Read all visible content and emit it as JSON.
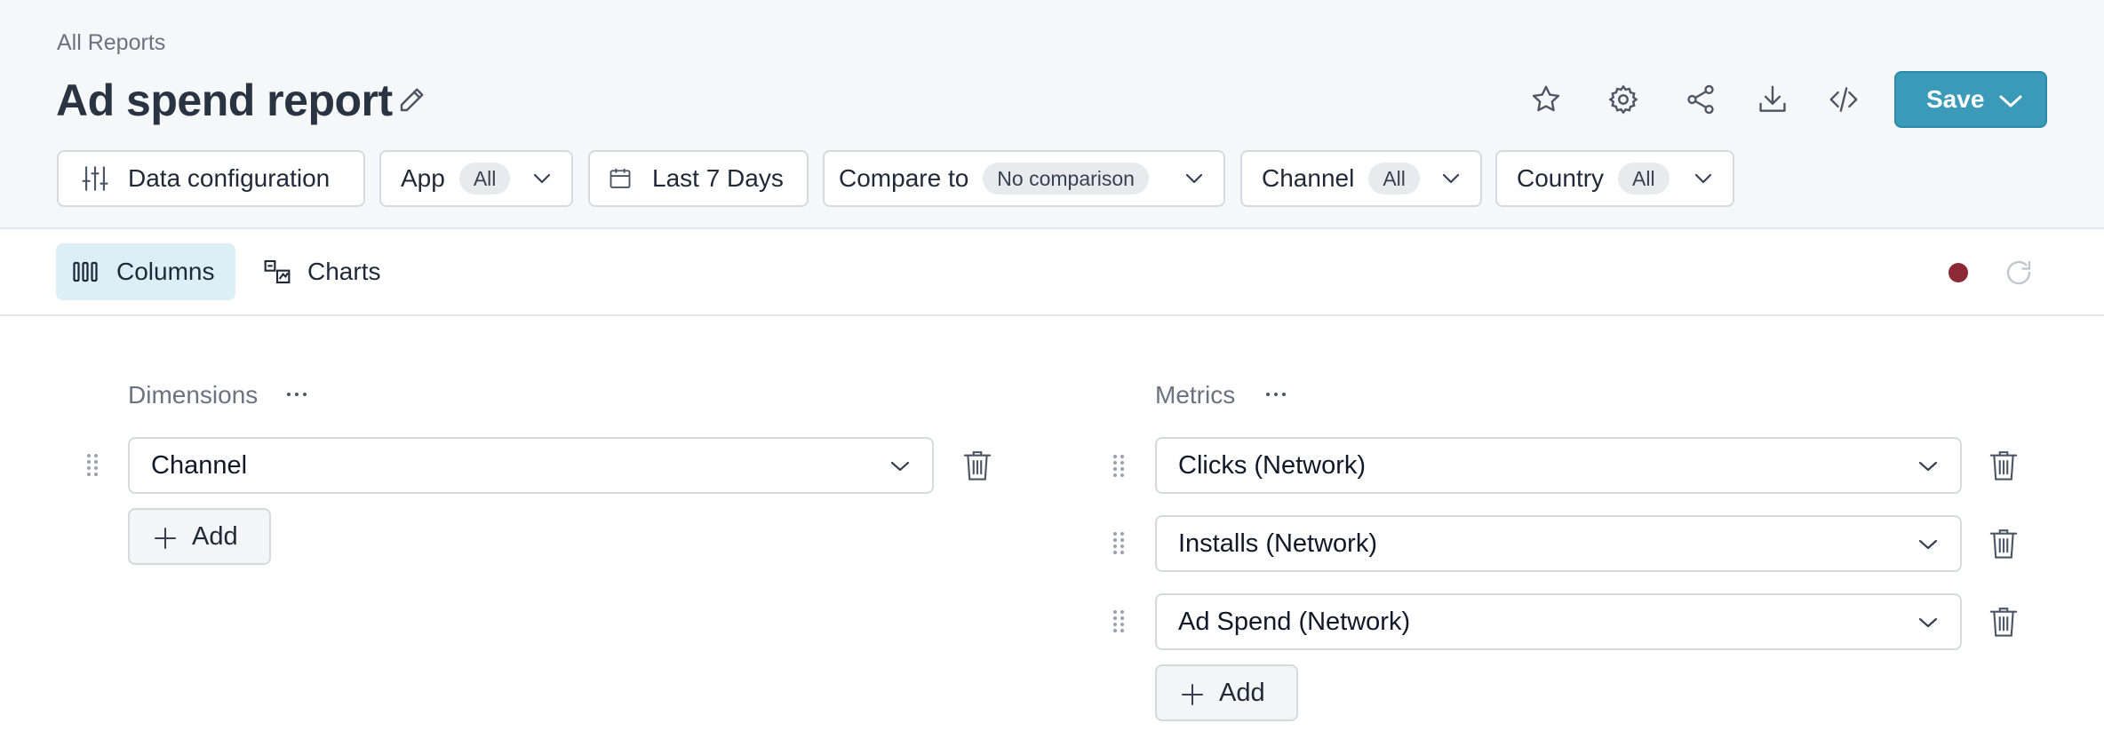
{
  "breadcrumb": "All Reports",
  "title": "Ad spend report",
  "actions": {
    "icons": [
      "star-icon",
      "gear-icon",
      "share-icon",
      "download-icon",
      "code-icon"
    ],
    "save_label": "Save"
  },
  "filters": {
    "data_config": "Data configuration",
    "app": {
      "label": "App",
      "value": "All"
    },
    "date_range": "Last 7 Days",
    "compare": {
      "label": "Compare to",
      "value": "No comparison"
    },
    "channel": {
      "label": "Channel",
      "value": "All"
    },
    "country": {
      "label": "Country",
      "value": "All"
    }
  },
  "tabs": [
    {
      "label": "Columns",
      "active": true
    },
    {
      "label": "Charts",
      "active": false
    }
  ],
  "status_color": "#8b2a36",
  "dimensions": {
    "label": "Dimensions",
    "items": [
      "Channel"
    ],
    "add_label": "Add"
  },
  "metrics": {
    "label": "Metrics",
    "items": [
      "Clicks (Network)",
      "Installs (Network)",
      "Ad Spend (Network)"
    ],
    "add_label": "Add"
  },
  "colors": {
    "accent": "#3b9ab8",
    "active_tab_bg": "#dceff6"
  }
}
